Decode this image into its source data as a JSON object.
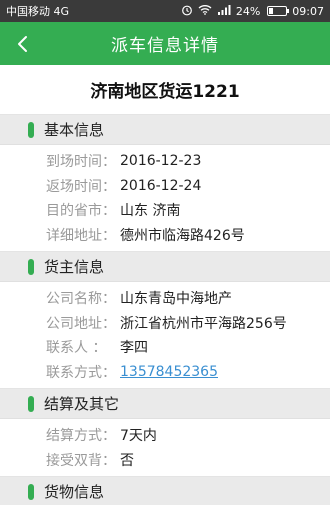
{
  "status_bar": {
    "carrier": "中国移动 4G",
    "battery": "24%",
    "battery_level": 0.24,
    "time": "09:07",
    "icons": [
      "alarm-icon",
      "wifi-icon",
      "signal-icon",
      "battery-icon"
    ]
  },
  "appbar": {
    "title": "派车信息详情",
    "back_icon": "chevron-left-icon"
  },
  "headline": "济南地区货运1221",
  "sections": [
    {
      "title": "基本信息",
      "rows": [
        {
          "key": "到场时间：",
          "value": "2016-12-23"
        },
        {
          "key": "返场时间：",
          "value": "2016-12-24"
        },
        {
          "key": "目的省市：",
          "value": "山东  济南"
        },
        {
          "key": "详细地址：",
          "value": "德州市临海路426号"
        }
      ]
    },
    {
      "title": "货主信息",
      "rows": [
        {
          "key": "公司名称：",
          "value": "山东青岛中海地产"
        },
        {
          "key": "公司地址：",
          "value": "浙江省杭州市平海路256号"
        },
        {
          "key": "联系人  ：",
          "value": "李四"
        },
        {
          "key": "联系方式：",
          "value": "13578452365",
          "link": true
        }
      ]
    },
    {
      "title": "结算及其它",
      "rows": [
        {
          "key": "结算方式：",
          "value": "7天内"
        },
        {
          "key": "接受双背：",
          "value": "否"
        }
      ]
    },
    {
      "title": "货物信息",
      "rows": []
    }
  ],
  "colors": {
    "accent": "#34ad52",
    "link": "#3a8fd1",
    "status_bar": "#3a3a3a"
  }
}
